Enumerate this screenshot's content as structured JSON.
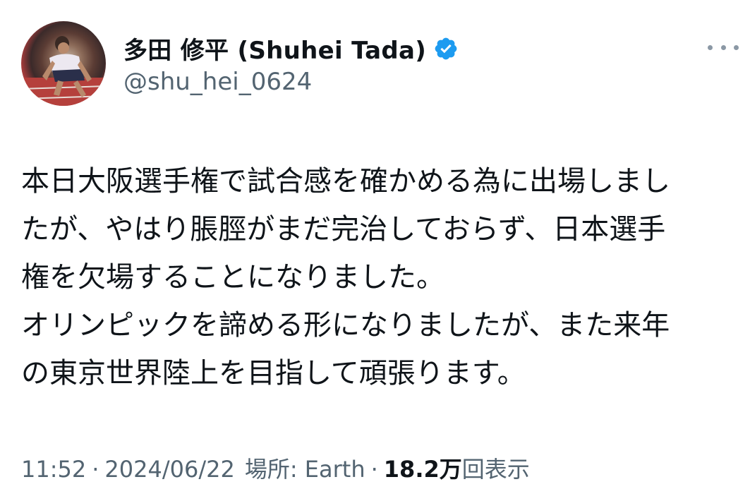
{
  "author": {
    "display_name": "多田 修平 (Shuhei Tada)",
    "handle": "@shu_hei_0624",
    "verified": true,
    "avatar_icon": "sprinter-avatar"
  },
  "menu": {
    "icon": "more-options-icon"
  },
  "tweet": {
    "lines": [
      "本日大阪選手権で試合感を確かめる為に出場しまし",
      "たが、やはり脹脛がまだ完治しておらず、日本選手",
      "権を欠場することになりました。",
      "オリンピックを諦める形になりましたが、また来年",
      "の東京世界陸上を目指して頑張ります。"
    ]
  },
  "meta": {
    "time": "11:52",
    "separator": "·",
    "date": "2024/06/22",
    "location_label": "場所: Earth",
    "views_count": "18.2万",
    "views_label": "回表示"
  },
  "colors": {
    "text_primary": "#0f1419",
    "text_secondary": "#536471",
    "verified_blue": "#1d9bf0"
  }
}
